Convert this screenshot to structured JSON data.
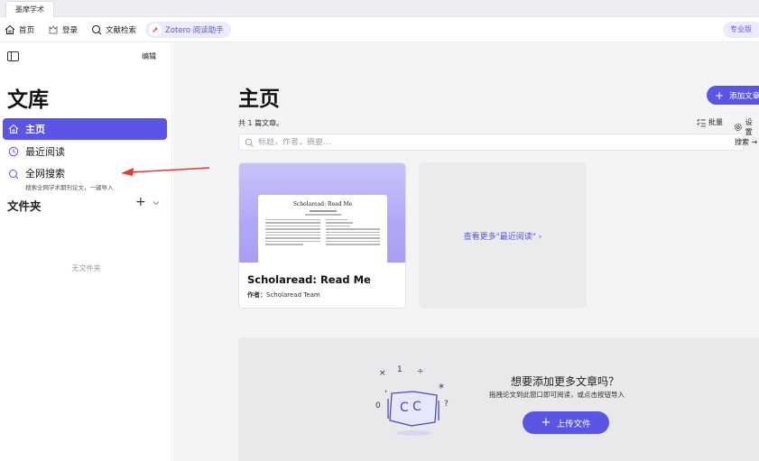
{
  "tabstrip": {
    "active_tab": "墨摩学术"
  },
  "toolbar": {
    "home_label": "首页",
    "login_label": "登录",
    "search_label": "文献检索",
    "zotero_label": "Zotero 阅读助手",
    "pro_label": "专业版"
  },
  "sidebar": {
    "edit_label": "编辑",
    "title": "文库",
    "nav": {
      "home": "主页",
      "recent": "最近阅读",
      "global_search": "全网搜索",
      "global_search_sub": "搜索全网学术期刊论文，一键导入"
    },
    "folders_title": "文件夹",
    "no_folder": "无文件夹"
  },
  "main": {
    "title": "主页",
    "count_text": "共 1 篇文章。",
    "add_button": "添加文章",
    "batch_label": "批量",
    "settings_label": "设置",
    "search_placeholder": "标题，作者，摘要...",
    "search_button": "搜索 →",
    "card": {
      "paper_heading": "Scholaread: Read Me",
      "title": "Scholaread: Read Me",
      "author_prefix": "作者：",
      "author": "Scholaread Team"
    },
    "more_link": "查看更多\"最近阅读\" ›",
    "upload": {
      "title": "想要添加更多文章吗？",
      "subtitle": "拖拽论文到此窗口即可阅读，或点击按钮导入",
      "button": "上传文件"
    }
  },
  "colors": {
    "accent": "#5b55e6",
    "annotation_arrow": "#e53935"
  }
}
